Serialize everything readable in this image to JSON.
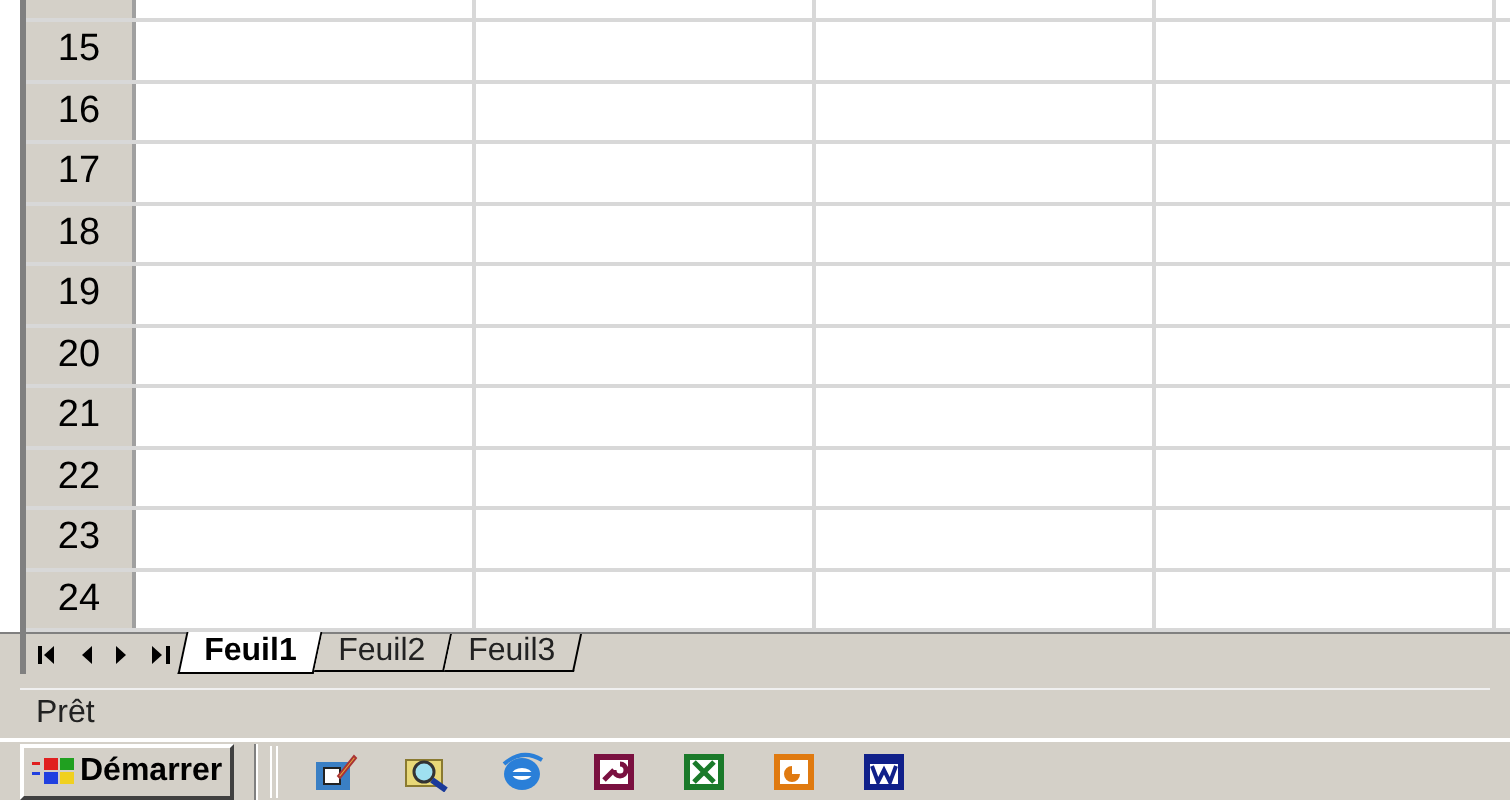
{
  "grid": {
    "rows": [
      {
        "label": "15"
      },
      {
        "label": "16"
      },
      {
        "label": "17"
      },
      {
        "label": "18"
      },
      {
        "label": "19"
      },
      {
        "label": "20"
      },
      {
        "label": "21"
      },
      {
        "label": "22"
      },
      {
        "label": "23"
      },
      {
        "label": "24"
      }
    ]
  },
  "sheet_tabs": [
    {
      "label": "Feuil1",
      "selected": true
    },
    {
      "label": "Feuil2",
      "selected": false
    },
    {
      "label": "Feuil3",
      "selected": false
    }
  ],
  "status_bar": {
    "text": "Prêt"
  },
  "taskbar": {
    "start_label": "Démarrer",
    "quick_launch": [
      {
        "kind": "outlook"
      },
      {
        "kind": "explorer"
      },
      {
        "kind": "ie"
      },
      {
        "kind": "access"
      },
      {
        "kind": "excel"
      },
      {
        "kind": "powerpoint"
      },
      {
        "kind": "word"
      }
    ]
  }
}
